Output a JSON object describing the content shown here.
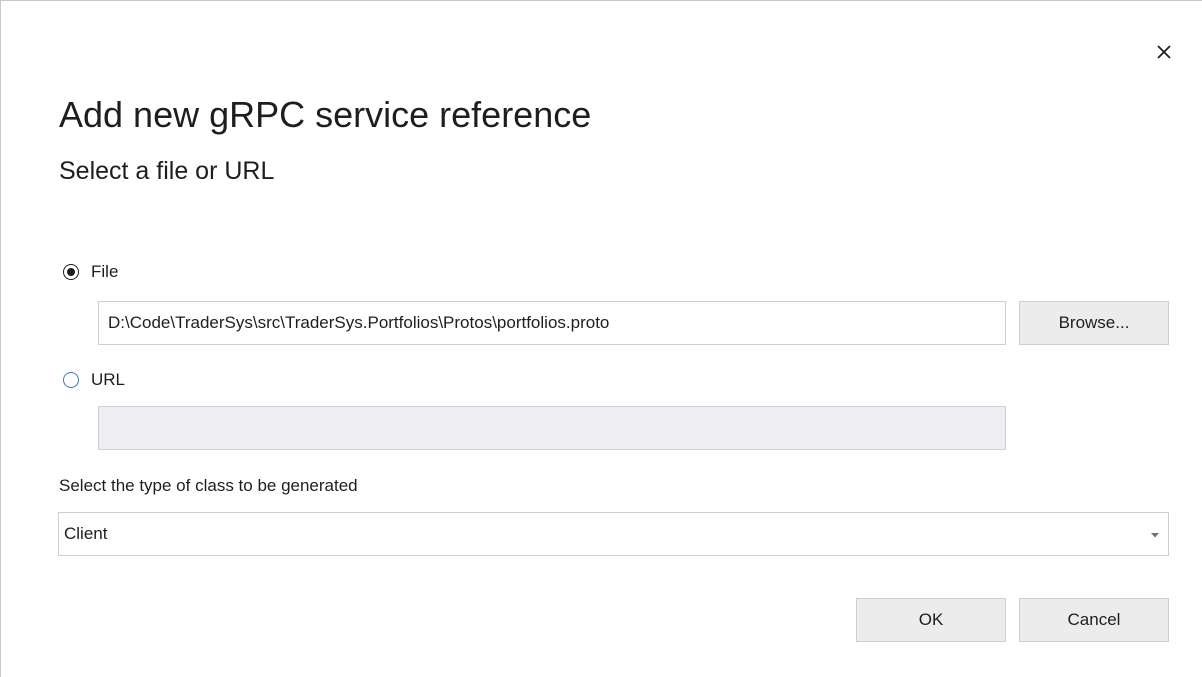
{
  "dialog": {
    "title": "Add new gRPC service reference",
    "subtitle": "Select a file or URL",
    "close_glyph": "×"
  },
  "source": {
    "file_option_label": "File",
    "file_selected": true,
    "file_path": "D:\\Code\\TraderSys\\src\\TraderSys.Portfolios\\Protos\\portfolios.proto",
    "browse_label": "Browse...",
    "url_option_label": "URL",
    "url_selected": false,
    "url_value": ""
  },
  "class_type": {
    "label": "Select the type of class to be generated",
    "selected": "Client"
  },
  "footer": {
    "ok_label": "OK",
    "cancel_label": "Cancel"
  },
  "colors": {
    "radio_unchecked_border": "#3c78c8",
    "button_background": "#ececec",
    "disabled_field_background": "#efeff2"
  }
}
